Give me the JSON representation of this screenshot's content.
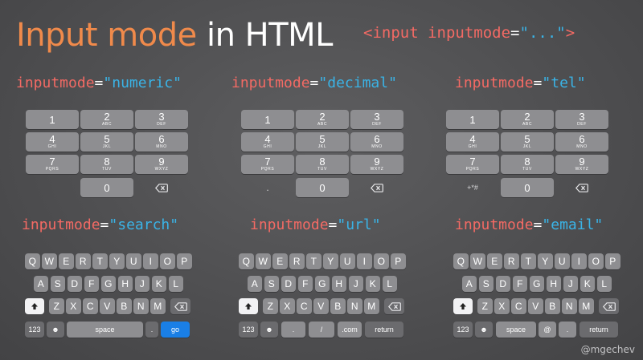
{
  "title": {
    "part1": "Input mode",
    "part2": "in HTML"
  },
  "code_snippet": {
    "open": "<input",
    "attr": "inputmode",
    "eq": "=",
    "value": "\"...\"",
    "close": ">"
  },
  "sections": {
    "numeric": {
      "kw": "inputmode",
      "eq": "=",
      "val": "\"numeric\""
    },
    "decimal": {
      "kw": "inputmode",
      "eq": "=",
      "val": "\"decimal\""
    },
    "tel": {
      "kw": "inputmode",
      "eq": "=",
      "val": "\"tel\""
    },
    "search": {
      "kw": "inputmode",
      "eq": "=",
      "val": "\"search\""
    },
    "url": {
      "kw": "inputmode",
      "eq": "=",
      "val": "\"url\""
    },
    "email": {
      "kw": "inputmode",
      "eq": "=",
      "val": "\"email\""
    }
  },
  "numpad": {
    "digits": [
      "1",
      "2",
      "3",
      "4",
      "5",
      "6",
      "7",
      "8",
      "9",
      "0"
    ],
    "letters": [
      "",
      "ABC",
      "DEF",
      "GHI",
      "JKL",
      "MNO",
      "PQRS",
      "TUV",
      "WXYZ"
    ],
    "decimal_point": ".",
    "tel_symbols": "+*#"
  },
  "qwerty": {
    "row1": [
      "Q",
      "W",
      "E",
      "R",
      "T",
      "Y",
      "U",
      "I",
      "O",
      "P"
    ],
    "row2": [
      "A",
      "S",
      "D",
      "F",
      "G",
      "H",
      "J",
      "K",
      "L"
    ],
    "row3": [
      "Z",
      "X",
      "C",
      "V",
      "B",
      "N",
      "M"
    ],
    "numbers_key": "123",
    "emoji_key": "☻",
    "shift_key": "⬆",
    "backspace_key": "⌫"
  },
  "search_bottom": {
    "space": "space",
    "dot": ".",
    "go": "go"
  },
  "url_bottom": {
    "dot": ".",
    "slash": "/",
    "com": ".com",
    "return": "return"
  },
  "email_bottom": {
    "space": "space",
    "at": "@",
    "dot": ".",
    "return": "return"
  },
  "colors": {
    "accent_orange": "#f08a4b",
    "code_red": "#f36a64",
    "code_blue": "#3ab3e6",
    "go_blue": "#1a7fe6",
    "key": "#8e8e91",
    "background": "#4f4f51"
  },
  "footer": {
    "handle": "@mgechev"
  }
}
